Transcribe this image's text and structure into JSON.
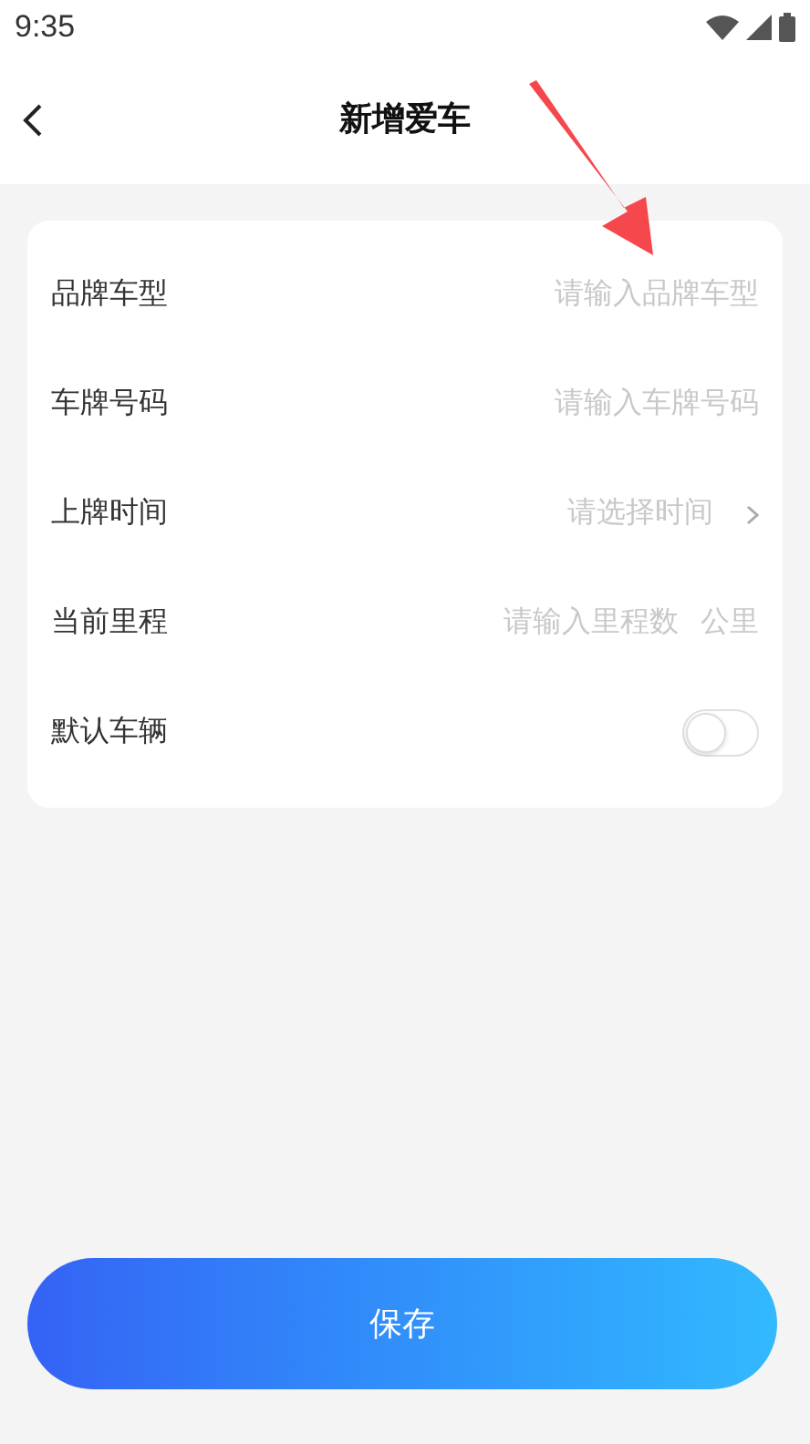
{
  "status_bar": {
    "time": "9:35"
  },
  "header": {
    "title": "新增爱车"
  },
  "fields": [
    {
      "kind": "input",
      "label": "品牌车型",
      "placeholder": "请输入品牌车型"
    },
    {
      "kind": "input",
      "label": "车牌号码",
      "placeholder": "请输入车牌号码"
    },
    {
      "kind": "select",
      "label": "上牌时间",
      "placeholder": "请选择时间"
    },
    {
      "kind": "unit",
      "label": "当前里程",
      "placeholder": "请输入里程数",
      "unit": "公里"
    },
    {
      "kind": "toggle",
      "label": "默认车辆",
      "on": false
    }
  ],
  "save_button": "保存"
}
